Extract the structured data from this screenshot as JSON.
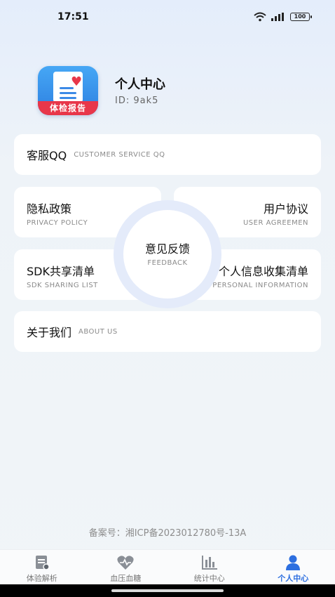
{
  "status": {
    "time": "17:51",
    "battery": "100"
  },
  "profile": {
    "logo_text": "体检报告",
    "name": "个人中心",
    "id": "ID: 9ak5"
  },
  "menu": {
    "customer_service": {
      "title": "客服QQ",
      "subtitle": "CUSTOMER SERVICE QQ"
    },
    "privacy_policy": {
      "title": "隐私政策",
      "subtitle": "PRIVACY POLICY"
    },
    "user_agreement": {
      "title": "用户协议",
      "subtitle": "USER AGREEMEN"
    },
    "feedback": {
      "title": "意见反馈",
      "subtitle": "FEEDBACK"
    },
    "sdk_sharing": {
      "title": "SDK共享清单",
      "subtitle": "SDK SHARING LIST"
    },
    "personal_info": {
      "title": "个人信息收集清单",
      "subtitle": "PERSONAL INFORMATION"
    },
    "about_us": {
      "title": "关于我们",
      "subtitle": "ABOUT US"
    }
  },
  "icp": "备案号：湘ICP备2023012780号-13A",
  "tabs": [
    {
      "label": "体验解析",
      "icon": "report-icon",
      "active": false
    },
    {
      "label": "血压血糖",
      "icon": "heart-icon",
      "active": false
    },
    {
      "label": "统计中心",
      "icon": "bar-chart-icon",
      "active": false
    },
    {
      "label": "个人中心",
      "icon": "person-icon",
      "active": true
    }
  ],
  "colors": {
    "accent": "#2d6fe0",
    "logo_red": "#e8374a"
  }
}
